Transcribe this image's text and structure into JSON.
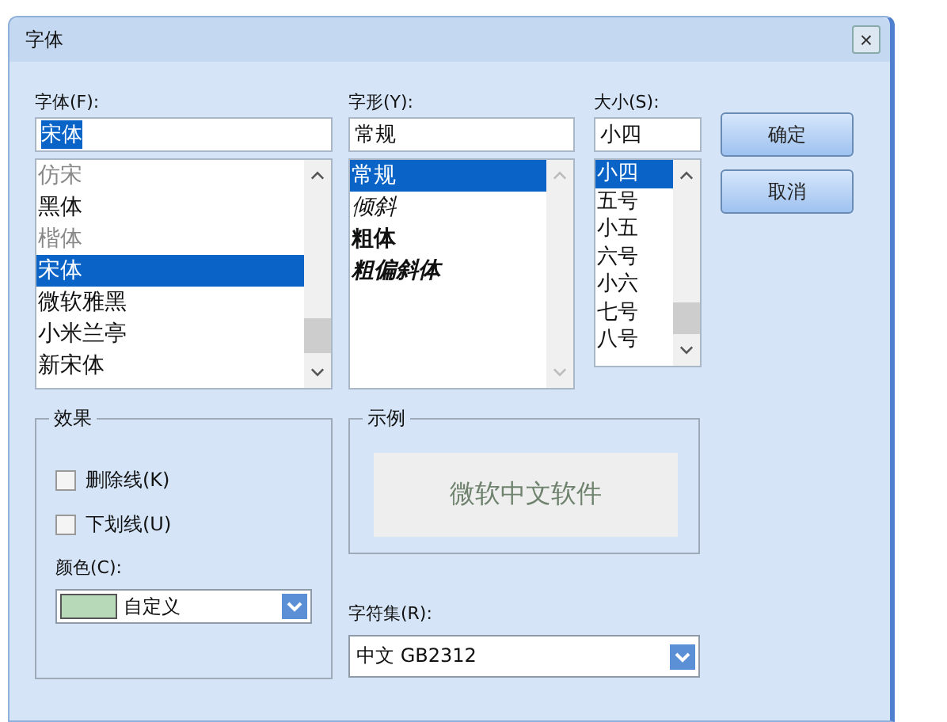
{
  "window": {
    "title": "字体",
    "close": "×"
  },
  "font": {
    "label": "字体(F):",
    "value": "宋体",
    "items": [
      {
        "label": "仿宋",
        "selected": false,
        "dimmed": true
      },
      {
        "label": "黑体",
        "selected": false,
        "dimmed": false
      },
      {
        "label": "楷体",
        "selected": false,
        "dimmed": true
      },
      {
        "label": "宋体",
        "selected": true,
        "dimmed": false
      },
      {
        "label": "微软雅黑",
        "selected": false,
        "dimmed": false
      },
      {
        "label": "小米兰亭",
        "selected": false,
        "dimmed": false
      },
      {
        "label": "新宋体",
        "selected": false,
        "dimmed": false
      }
    ]
  },
  "style": {
    "label": "字形(Y):",
    "value": "常规",
    "items": [
      {
        "label": "常规",
        "selected": true,
        "kind": "regular"
      },
      {
        "label": "倾斜",
        "selected": false,
        "kind": "italic"
      },
      {
        "label": "粗体",
        "selected": false,
        "kind": "bold"
      },
      {
        "label": "粗偏斜体",
        "selected": false,
        "kind": "bold-italic"
      }
    ]
  },
  "size": {
    "label": "大小(S):",
    "value": "小四",
    "items": [
      {
        "label": "小四",
        "selected": true
      },
      {
        "label": "五号",
        "selected": false
      },
      {
        "label": "小五",
        "selected": false
      },
      {
        "label": "六号",
        "selected": false
      },
      {
        "label": "小六",
        "selected": false
      },
      {
        "label": "七号",
        "selected": false
      },
      {
        "label": "八号",
        "selected": false
      }
    ]
  },
  "buttons": [
    "确定",
    "取消"
  ],
  "effects": {
    "title": "效果",
    "options": [
      {
        "label": "删除线(K)",
        "checked": false
      },
      {
        "label": "下划线(U)",
        "checked": false
      }
    ],
    "color_label": "颜色(C):",
    "color": {
      "label": "自定义",
      "color": "#b7d9b7"
    }
  },
  "sample": {
    "title": "示例",
    "text": "微软中文软件"
  },
  "charset": {
    "label": "字符集(R):",
    "value": "中文 GB2312"
  }
}
